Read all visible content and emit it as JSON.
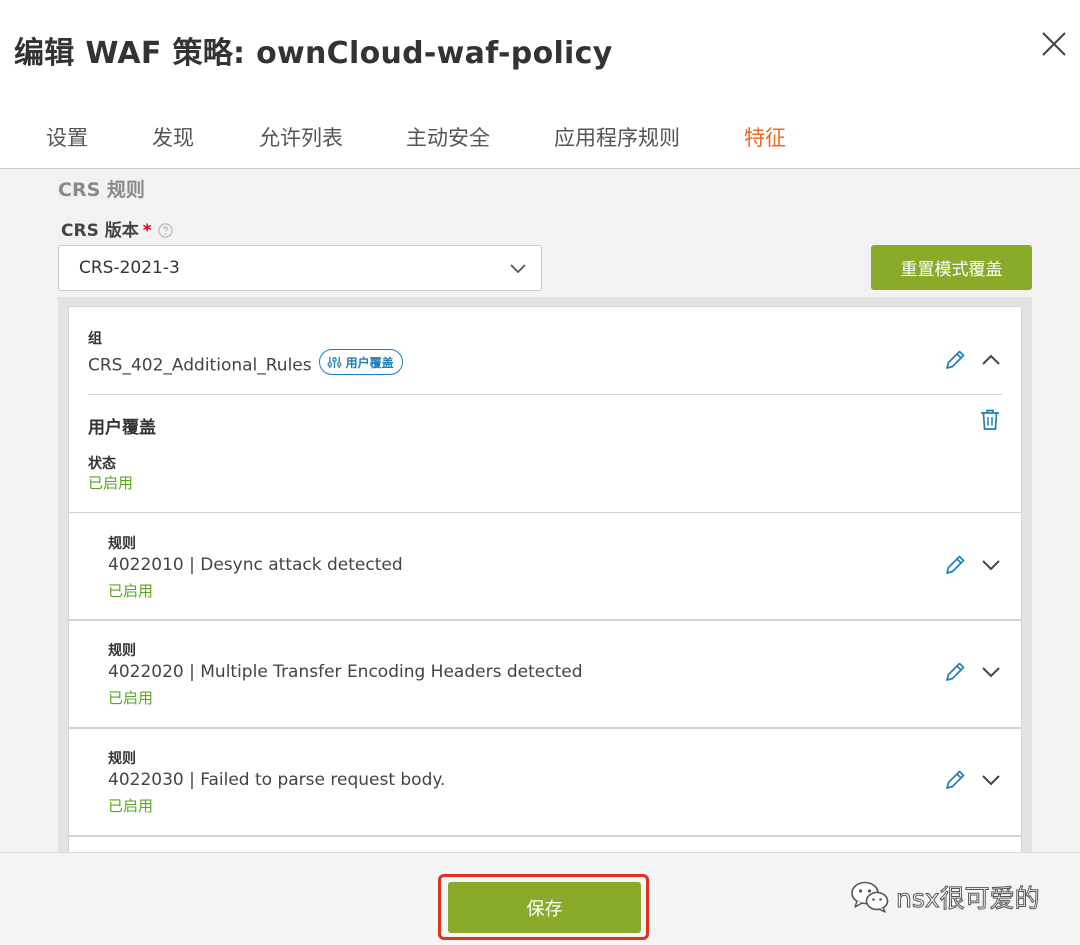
{
  "modal": {
    "title": "编辑 WAF 策略: ownCloud-waf-policy"
  },
  "tabs": [
    {
      "label": "设置"
    },
    {
      "label": "发现"
    },
    {
      "label": "允许列表"
    },
    {
      "label": "主动安全"
    },
    {
      "label": "应用程序规则"
    },
    {
      "label": "特征",
      "active": true
    }
  ],
  "crs": {
    "section_title": "CRS 规则",
    "version_label": "CRS 版本",
    "required_mark": "*",
    "version_value": "CRS-2021-3",
    "reset_button": "重置模式覆盖"
  },
  "group": {
    "label": "组",
    "name": "CRS_402_Additional_Rules",
    "badge": "用户覆盖",
    "override_title": "用户覆盖",
    "state_label": "状态",
    "state_value": "已启用"
  },
  "rules": [
    {
      "label": "规则",
      "text": "4022010 | Desync attack detected",
      "status": "已启用"
    },
    {
      "label": "规则",
      "text": "4022020 | Multiple Transfer Encoding Headers detected",
      "status": "已启用"
    },
    {
      "label": "规则",
      "text": "4022030 | Failed to parse request body.",
      "status": "已启用"
    }
  ],
  "footer": {
    "save_button": "保存",
    "watermark": "nsx很可爱的"
  },
  "colors": {
    "accent_active_tab": "#f26722",
    "primary_button": "#8aab2a",
    "status_green": "#5aa620",
    "link_blue": "#1e80b9",
    "highlight_red": "#e0301e"
  },
  "icons": [
    "close-icon",
    "help-icon",
    "chevron-down-icon",
    "sliders-icon",
    "pencil-icon",
    "chevron-up-icon",
    "trash-icon",
    "wechat-icon"
  ]
}
